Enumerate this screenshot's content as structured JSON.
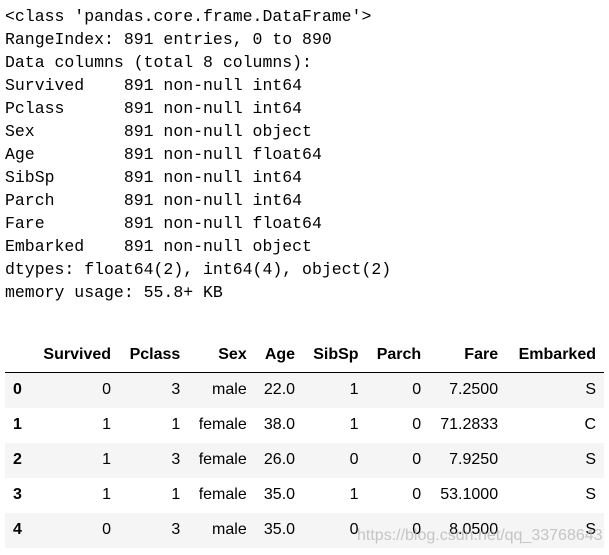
{
  "info_lines": [
    "<class 'pandas.core.frame.DataFrame'>",
    "RangeIndex: 891 entries, 0 to 890",
    "Data columns (total 8 columns):",
    "Survived    891 non-null int64",
    "Pclass      891 non-null int64",
    "Sex         891 non-null object",
    "Age         891 non-null float64",
    "SibSp       891 non-null int64",
    "Parch       891 non-null int64",
    "Fare        891 non-null float64",
    "Embarked    891 non-null object",
    "dtypes: float64(2), int64(4), object(2)",
    "memory usage: 55.8+ KB"
  ],
  "table": {
    "columns": [
      "",
      "Survived",
      "Pclass",
      "Sex",
      "Age",
      "SibSp",
      "Parch",
      "Fare",
      "Embarked"
    ],
    "rows": [
      [
        "0",
        "0",
        "3",
        "male",
        "22.0",
        "1",
        "0",
        "7.2500",
        "S"
      ],
      [
        "1",
        "1",
        "1",
        "female",
        "38.0",
        "1",
        "0",
        "71.2833",
        "C"
      ],
      [
        "2",
        "1",
        "3",
        "female",
        "26.0",
        "0",
        "0",
        "7.9250",
        "S"
      ],
      [
        "3",
        "1",
        "1",
        "female",
        "35.0",
        "1",
        "0",
        "53.1000",
        "S"
      ],
      [
        "4",
        "0",
        "3",
        "male",
        "35.0",
        "0",
        "0",
        "8.0500",
        "S"
      ]
    ]
  },
  "watermark": "https://blog.csdn.net/qq_33768643"
}
